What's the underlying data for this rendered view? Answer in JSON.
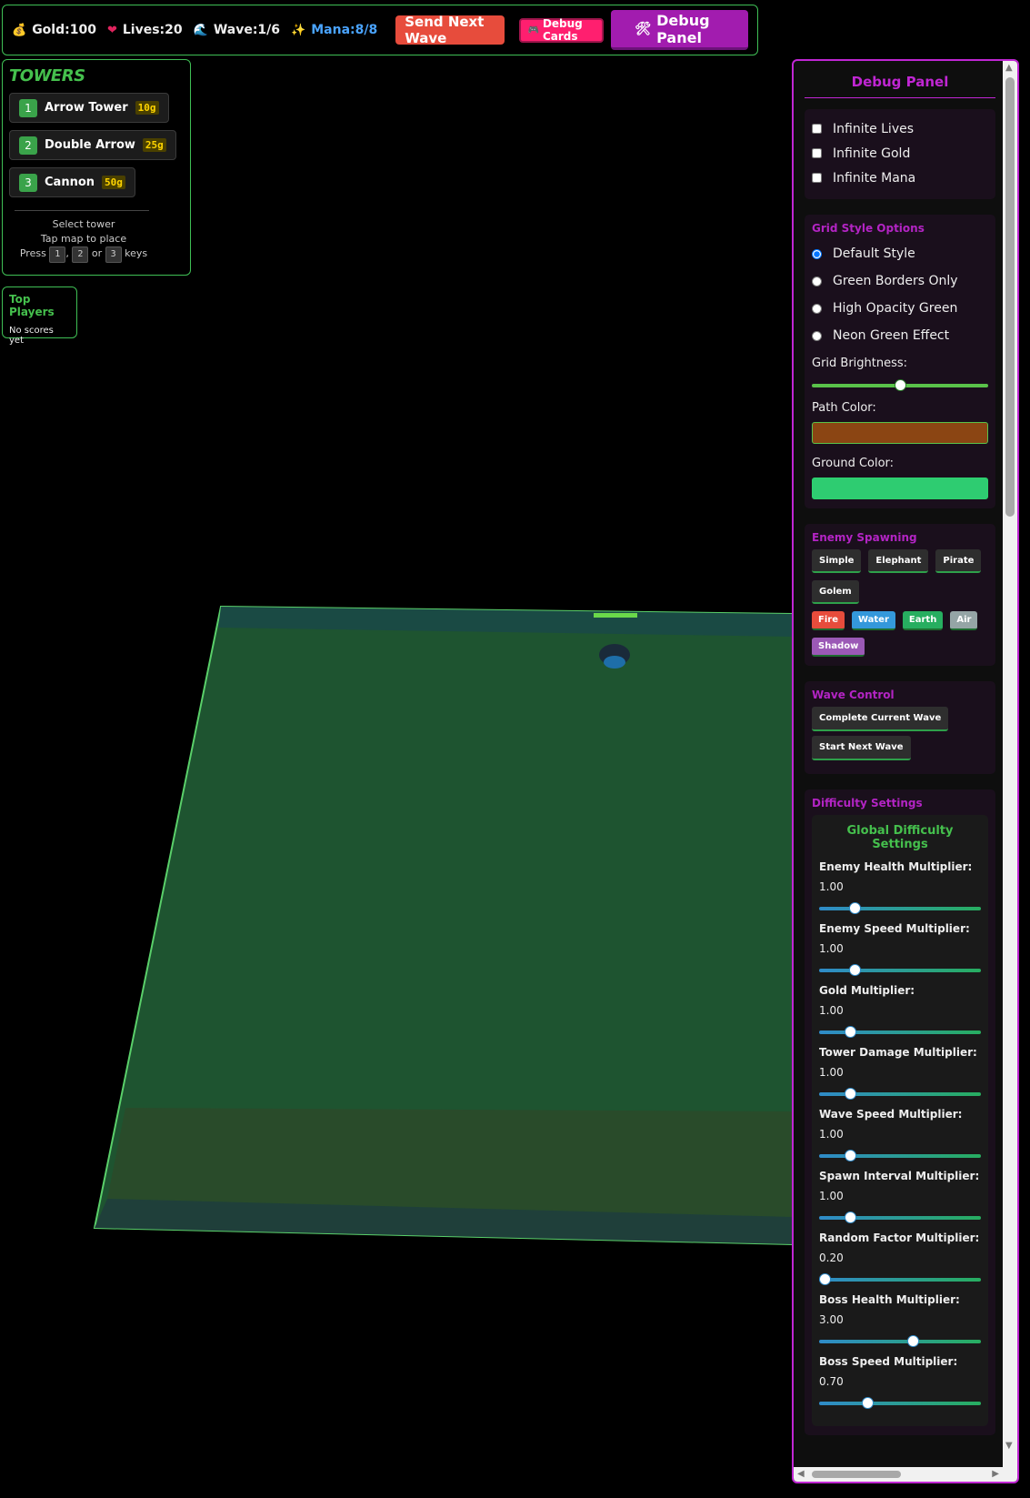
{
  "hud": {
    "gold": "Gold:100",
    "lives": "Lives:20",
    "wave": "Wave:1/6",
    "mana": "Mana:8/8",
    "send_wave": "Send Next Wave",
    "debug_cards": "Debug Cards",
    "debug_panel": "Debug Panel",
    "icons": [
      "money-bag-icon",
      "heart-icon",
      "wave-icon",
      "sparkle-icon",
      "gamepad-icon",
      "tools-icon"
    ]
  },
  "towers": {
    "title": "TOWERS",
    "items": [
      {
        "key": "1",
        "name": "Arrow Tower",
        "cost": "10g"
      },
      {
        "key": "2",
        "name": "Double Arrow",
        "cost": "25g"
      },
      {
        "key": "3",
        "name": "Cannon",
        "cost": "50g"
      }
    ],
    "help_line1": "Select tower",
    "help_line2": "Tap map to place",
    "press": "Press",
    "or": "or",
    "keys": "keys"
  },
  "players": {
    "title": "Top Players",
    "empty": "No scores yet"
  },
  "debug": {
    "title": "Debug Panel",
    "checkboxes": [
      "Infinite Lives",
      "Infinite Gold",
      "Infinite Mana"
    ],
    "grid": {
      "heading": "Grid Style Options",
      "options": [
        "Default Style",
        "Green Borders Only",
        "High Opacity Green",
        "Neon Green Effect"
      ],
      "selected": "Default Style",
      "brightness_label": "Grid Brightness:",
      "brightness_value": 0.5,
      "path_label": "Path Color:",
      "path_color": "#8b4513",
      "ground_label": "Ground Color:",
      "ground_color": "#2ecc71"
    },
    "spawning": {
      "heading": "Enemy Spawning",
      "types": [
        "Simple",
        "Elephant",
        "Pirate",
        "Golem"
      ],
      "elements": [
        {
          "label": "Fire",
          "color": "#e74c3c"
        },
        {
          "label": "Water",
          "color": "#3498db"
        },
        {
          "label": "Earth",
          "color": "#27ae60"
        },
        {
          "label": "Air",
          "color": "#95a5a6"
        },
        {
          "label": "Shadow",
          "color": "#9b59b6"
        }
      ]
    },
    "wave": {
      "heading": "Wave Control",
      "complete": "Complete Current Wave",
      "start": "Start Next Wave"
    },
    "difficulty": {
      "heading": "Difficulty Settings",
      "box_title": "Global Difficulty Settings",
      "multipliers": [
        {
          "label": "Enemy Health Multiplier:",
          "value": "1.00",
          "pos": 0.22
        },
        {
          "label": "Enemy Speed Multiplier:",
          "value": "1.00",
          "pos": 0.22
        },
        {
          "label": "Gold Multiplier:",
          "value": "1.00",
          "pos": 0.19
        },
        {
          "label": "Tower Damage Multiplier:",
          "value": "1.00",
          "pos": 0.19
        },
        {
          "label": "Wave Speed Multiplier:",
          "value": "1.00",
          "pos": 0.19
        },
        {
          "label": "Spawn Interval Multiplier:",
          "value": "1.00",
          "pos": 0.19
        },
        {
          "label": "Random Factor Multiplier:",
          "value": "0.20",
          "pos": 0.0
        },
        {
          "label": "Boss Health Multiplier:",
          "value": "3.00",
          "pos": 0.58
        },
        {
          "label": "Boss Speed Multiplier:",
          "value": "0.70",
          "pos": 0.3
        }
      ]
    }
  }
}
